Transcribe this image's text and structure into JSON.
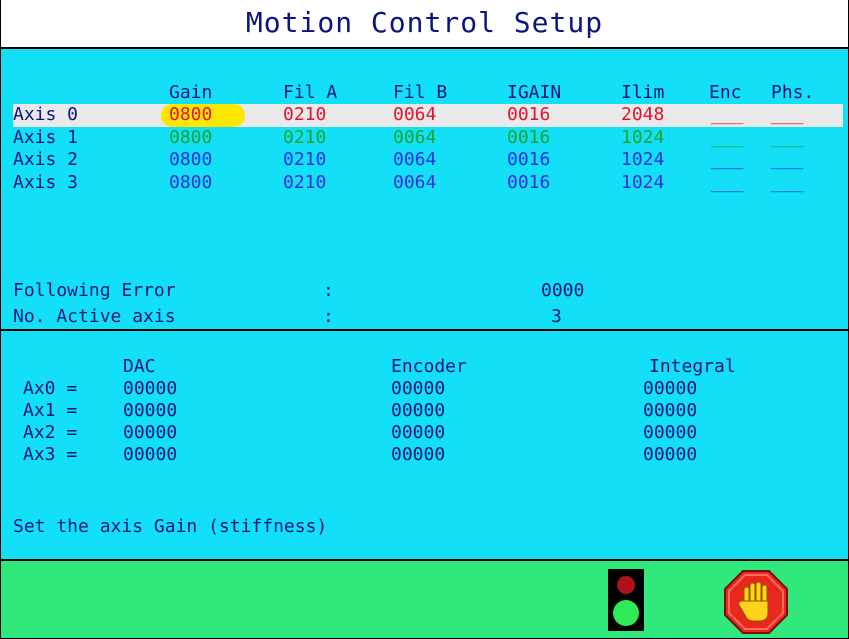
{
  "window": {
    "title": "Motion Control Setup"
  },
  "table": {
    "headers": [
      "Gain",
      "Fil A",
      "Fil B",
      "IGAIN",
      "Ilim",
      "Enc",
      "Phs."
    ],
    "rows": [
      {
        "label": "Axis 0",
        "gain": "0800",
        "fila": "0210",
        "filb": "0064",
        "igain": "0016",
        "ilim": "2048",
        "enc": "___",
        "phs": "___",
        "color": "#e6112b"
      },
      {
        "label": "Axis 1",
        "gain": "0800",
        "fila": "0210",
        "filb": "0064",
        "igain": "0016",
        "ilim": "1024",
        "enc": "___",
        "phs": "___",
        "color": "#0fa52e"
      },
      {
        "label": "Axis 2",
        "gain": "0800",
        "fila": "0210",
        "filb": "0064",
        "igain": "0016",
        "ilim": "1024",
        "enc": "___",
        "phs": "___",
        "color": "#1a2fe6"
      },
      {
        "label": "Axis 3",
        "gain": "0800",
        "fila": "0210",
        "filb": "0064",
        "igain": "0016",
        "ilim": "1024",
        "enc": "___",
        "phs": "___",
        "color": "#3a2fd6"
      }
    ],
    "selected_row": 0
  },
  "status": {
    "following_error": {
      "label": "Following Error",
      "sep": ":",
      "value": "0000"
    },
    "active_axis": {
      "label": "No. Active axis",
      "sep": ":",
      "value": "3"
    }
  },
  "monitor": {
    "headers": {
      "dac": "DAC",
      "encoder": "Encoder",
      "integral": "Integral"
    },
    "rows": [
      {
        "label": "Ax0 =",
        "dac": "00000",
        "encoder": "00000",
        "integral": "00000"
      },
      {
        "label": "Ax1 =",
        "dac": "00000",
        "encoder": "00000",
        "integral": "00000"
      },
      {
        "label": "Ax2 =",
        "dac": "00000",
        "encoder": "00000",
        "integral": "00000"
      },
      {
        "label": "Ax3 =",
        "dac": "00000",
        "encoder": "00000",
        "integral": "00000"
      }
    ]
  },
  "help_text": "Set the axis Gain (stiffness)",
  "footer": {
    "icons": [
      "traffic-light-icon",
      "stop-hand-icon"
    ]
  },
  "colors": {
    "title_bg": "#ffffff",
    "panel_bg": "#13dff7",
    "footer_bg": "#31e87c",
    "text": "#0a1580",
    "highlight": "#ffe600",
    "selected_row_bg": "#e9e9e9"
  }
}
